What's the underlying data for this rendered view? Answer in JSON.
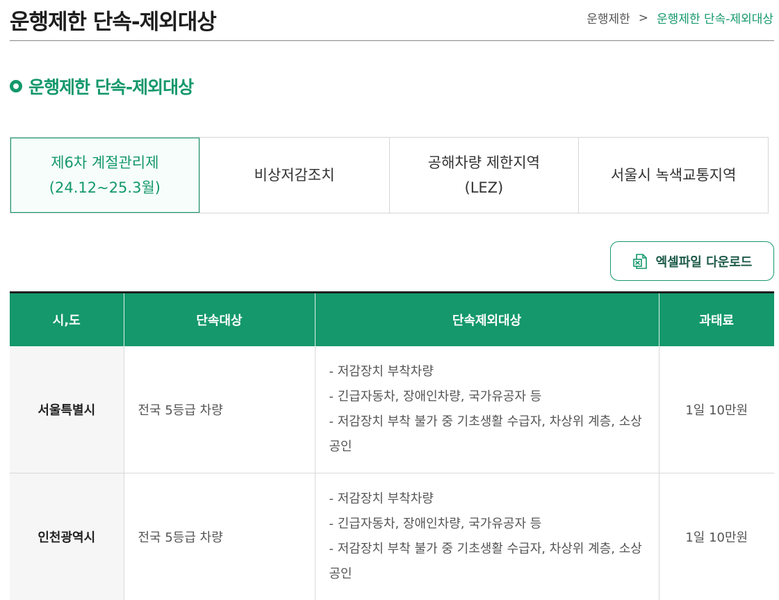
{
  "header": {
    "title": "운행제한 단속-제외대상",
    "breadcrumb": {
      "home": "운행제한",
      "separator": ">",
      "current": "운행제한 단속-제외대상"
    }
  },
  "section": {
    "title": "운행제한 단속-제외대상"
  },
  "tabs": [
    {
      "label": "제6차 계절관리제\n(24.12~25.3월)",
      "active": true
    },
    {
      "label": "비상저감조치",
      "active": false
    },
    {
      "label": "공해차량 제한지역\n(LEZ)",
      "active": false
    },
    {
      "label": "서울시 녹색교통지역",
      "active": false
    }
  ],
  "excel_button": {
    "label": "엑셀파일 다운로드",
    "icon": "excel-file-icon"
  },
  "table": {
    "headers": [
      "시,도",
      "단속대상",
      "단속제외대상",
      "과태료"
    ],
    "rows": [
      {
        "region": "서울특별시",
        "target": "전국 5등급 차량",
        "exclusions": [
          "- 저감장치 부착차량",
          "- 긴급자동차, 장애인차량, 국가유공자 등",
          "- 저감장치 부착 불가 중 기초생활 수급자, 차상위 계층, 소상공인"
        ],
        "fine": "1일 10만원"
      },
      {
        "region": "인천광역시",
        "target": "전국 5등급 차량",
        "exclusions": [
          "- 저감장치 부착차량",
          "- 긴급자동차, 장애인차량, 국가유공자 등",
          "- 저감장치 부착 불가 중 기초생활 수급자, 차상위 계층, 소상공인"
        ],
        "fine": "1일 10만원"
      }
    ]
  },
  "colors": {
    "accent": "#14986c",
    "header_text": "#ffffff",
    "border": "#d8d8d8",
    "active_tab_bg": "#f6fdfb"
  }
}
